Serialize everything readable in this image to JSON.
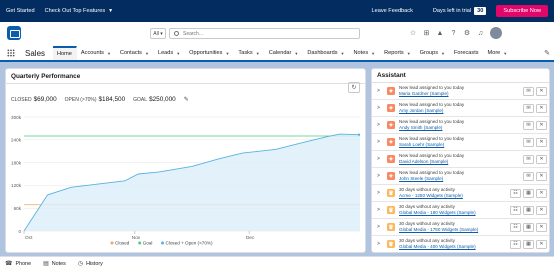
{
  "trial_bar": {
    "get_started": "Get Started",
    "check_out": "Check Out Top Features",
    "leave_feedback": "Leave Feedback",
    "days_left_label": "Days left in trial",
    "days_left_value": "30",
    "subscribe": "Subscribe Now"
  },
  "global_header": {
    "scope_label": "All",
    "search_placeholder": "Search..."
  },
  "nav": {
    "app_name": "Sales",
    "items": [
      {
        "label": "Home",
        "dropdown": false,
        "active": true
      },
      {
        "label": "Accounts",
        "dropdown": true
      },
      {
        "label": "Contacts",
        "dropdown": true
      },
      {
        "label": "Leads",
        "dropdown": true
      },
      {
        "label": "Opportunities",
        "dropdown": true
      },
      {
        "label": "Tasks",
        "dropdown": true
      },
      {
        "label": "Calendar",
        "dropdown": true
      },
      {
        "label": "Dashboards",
        "dropdown": true
      },
      {
        "label": "Notes",
        "dropdown": true
      },
      {
        "label": "Reports",
        "dropdown": true
      },
      {
        "label": "Groups",
        "dropdown": true
      },
      {
        "label": "Forecasts",
        "dropdown": false
      },
      {
        "label": "More",
        "dropdown": true
      }
    ]
  },
  "performance": {
    "title": "Quarterly Performance",
    "closed_label": "CLOSED",
    "closed_value": "$69,000",
    "open_label": "OPEN (>70%)",
    "open_value": "$184,500",
    "goal_label": "GOAL",
    "goal_value": "$250,000"
  },
  "chart_data": {
    "type": "line",
    "x_ticks": [
      "Oct",
      "Nov",
      "Dec"
    ],
    "y_ticks": [
      "0",
      "60k",
      "120k",
      "180k",
      "240k",
      "300k"
    ],
    "ylim": [
      0,
      300000
    ],
    "legend": [
      "Closed",
      "Goal",
      "Closed + Open (>70%)"
    ],
    "legend_position": "bottom",
    "series": [
      {
        "name": "Closed",
        "color": "#f2a35e",
        "x": [
          0,
          1
        ],
        "values": [
          69000,
          69000
        ]
      },
      {
        "name": "Goal",
        "color": "#4bca81",
        "x": [
          0,
          1
        ],
        "values": [
          250000,
          250000
        ]
      },
      {
        "name": "Closed + Open (>70%)",
        "color": "#58b3e0",
        "area": true,
        "x": [
          0,
          0.07,
          0.14,
          0.3,
          0.34,
          0.4,
          0.5,
          0.58,
          0.65,
          0.75,
          0.84,
          0.9,
          0.94,
          1.0
        ],
        "values": [
          0,
          95000,
          115000,
          132000,
          150000,
          155000,
          170000,
          190000,
          205000,
          215000,
          235000,
          248000,
          255000,
          253500
        ]
      }
    ]
  },
  "assistant": {
    "title": "Assistant",
    "items": [
      {
        "type": "lead",
        "text": "New lead assigned to you today",
        "link": "Maria Gardner (Sample)"
      },
      {
        "type": "lead",
        "text": "New lead assigned to you today",
        "link": "Amy Jordan (Sample)"
      },
      {
        "type": "lead",
        "text": "New lead assigned to you today",
        "link": "Andy Smith (Sample)"
      },
      {
        "type": "lead",
        "text": "New lead assigned to you today",
        "link": "Sarah Loehr (Sample)"
      },
      {
        "type": "lead",
        "text": "New lead assigned to you today",
        "link": "David Adelson (Sample)"
      },
      {
        "type": "lead",
        "text": "New lead assigned to you today",
        "link": "John Steele (Sample)"
      },
      {
        "type": "opp",
        "text": "30 days without any activity",
        "link": "Acme - 1250 Widgets (Sample)"
      },
      {
        "type": "opp",
        "text": "30 days without any activity",
        "link": "Global Media - 180 Widgets (Sample)"
      },
      {
        "type": "opp",
        "text": "30 days without any activity",
        "link": "Global Media - 1750 Widgets (Sample)"
      },
      {
        "type": "opp",
        "text": "30 days without any activity",
        "link": "Global Media - 400 Widgets (Sample)"
      }
    ]
  },
  "utility_bar": {
    "phone": "Phone",
    "notes": "Notes",
    "history": "History"
  }
}
